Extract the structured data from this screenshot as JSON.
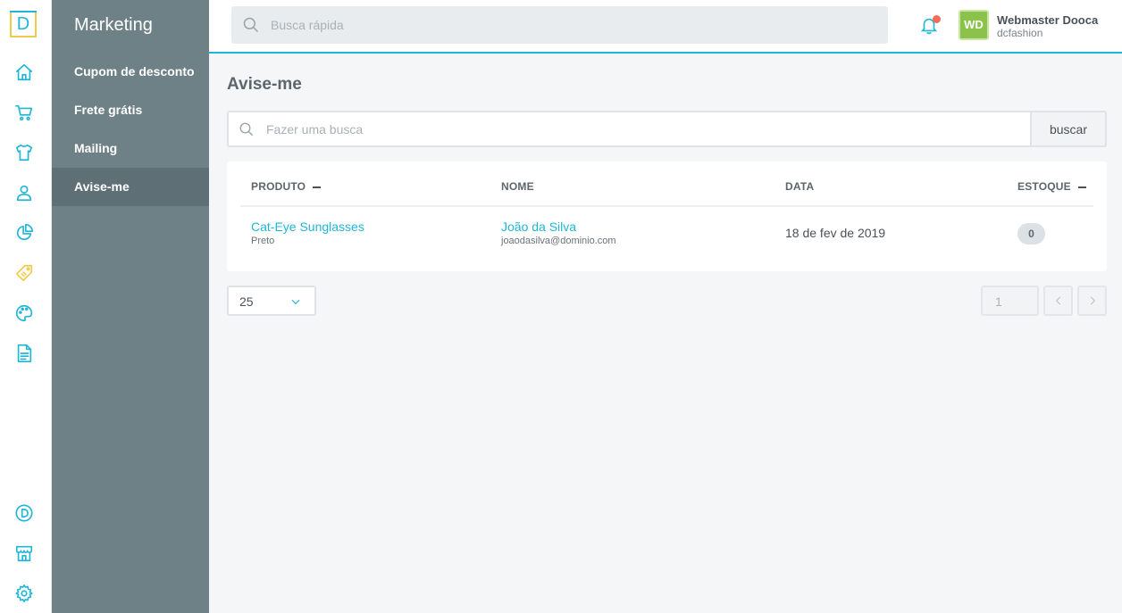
{
  "app": {
    "logo_letter": "D"
  },
  "subnav": {
    "title": "Marketing",
    "items": [
      {
        "label": "Cupom de desconto",
        "active": false
      },
      {
        "label": "Frete grátis",
        "active": false
      },
      {
        "label": "Mailing",
        "active": false
      },
      {
        "label": "Avise-me",
        "active": true
      }
    ]
  },
  "topbar": {
    "search_placeholder": "Busca rápida",
    "user": {
      "initials": "WD",
      "name": "Webmaster Dooca",
      "store": "dcfashion"
    }
  },
  "page": {
    "title": "Avise-me",
    "search_placeholder": "Fazer uma busca",
    "search_button": "buscar"
  },
  "table": {
    "headers": {
      "product": "PRODUTO",
      "name": "NOME",
      "date": "DATA",
      "stock": "ESTOQUE"
    },
    "rows": [
      {
        "product": "Cat-Eye Sunglasses",
        "variant": "Preto",
        "customer_name": "João da Silva",
        "customer_email": "joaodasilva@dominio.com",
        "date": "18 de fev de 2019",
        "stock": "0"
      }
    ]
  },
  "pagination": {
    "per_page": "25",
    "current_page": "1"
  },
  "colors": {
    "accent": "#20b6d8",
    "sidebar": "#6e8186",
    "alert_dot": "#f26b5b",
    "avatar": "#8bc34a",
    "tag_icon": "#f2c94c"
  },
  "rail_icons": [
    "home-icon",
    "cart-icon",
    "shirt-icon",
    "user-icon",
    "pie-chart-icon",
    "tag-icon",
    "palette-icon",
    "document-icon",
    "dooca-icon",
    "store-icon",
    "gear-icon"
  ]
}
